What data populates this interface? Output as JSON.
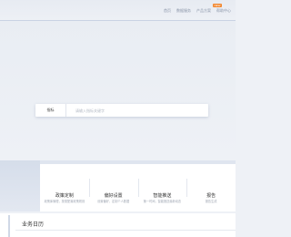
{
  "nav": {
    "items": [
      "首页",
      "数据服务",
      "产品方案",
      "帮助中心"
    ],
    "badge": "NEW"
  },
  "search": {
    "scope": "指标",
    "placeholder": "请输入指标关键字"
  },
  "features": [
    {
      "title": "政策定制",
      "desc": "政策库管理，按需配置政策规则"
    },
    {
      "title": "偏好设置",
      "desc": "设置偏好，定制个人数据"
    },
    {
      "title": "智能推送",
      "desc": "第一时间，智能推送最新动态"
    },
    {
      "title": "报告",
      "desc": "报告生成"
    }
  ],
  "section": {
    "title": "业务日历"
  },
  "colors": {
    "accent": "#f2872f",
    "border": "#c9d3e4",
    "band": "#dfe5ef"
  }
}
